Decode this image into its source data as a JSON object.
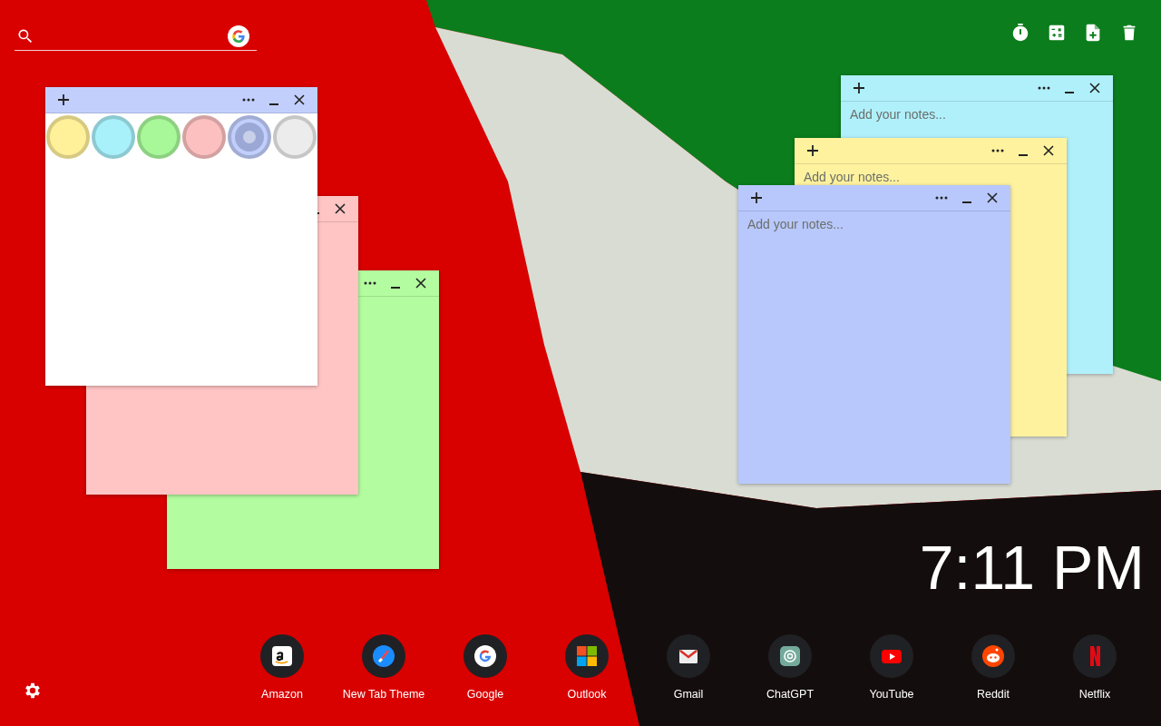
{
  "notes": [
    {
      "kind": "text",
      "color": "#b3fca0"
    },
    {
      "kind": "text",
      "color": "#ffc4c4"
    },
    {
      "kind": "palette",
      "color": "#ffffff",
      "swatches": [
        {
          "color": "#fff09a",
          "selected": false
        },
        {
          "color": "#a8f0fa",
          "selected": false
        },
        {
          "color": "#a8f89a",
          "selected": false
        },
        {
          "color": "#fcc0c0",
          "selected": false
        },
        {
          "color": "#c2cffc",
          "selected": true
        },
        {
          "color": "#ececec",
          "selected": false
        }
      ]
    },
    {
      "kind": "text",
      "color": "#b0f0fb",
      "placeholder": "Add your notes..."
    },
    {
      "kind": "text",
      "color": "#fff29e",
      "placeholder": "Add your notes..."
    },
    {
      "kind": "text",
      "color": "#b8c8fc",
      "placeholder": "Add your notes..."
    }
  ],
  "clock": {
    "time": "7:11 PM"
  },
  "shortcuts": [
    {
      "kind": "amazon",
      "label": "Amazon"
    },
    {
      "kind": "brush",
      "label": "New Tab Theme"
    },
    {
      "kind": "google",
      "label": "Google"
    },
    {
      "kind": "windows",
      "label": "Outlook"
    },
    {
      "kind": "mail",
      "label": "Gmail"
    },
    {
      "kind": "chatgpt",
      "label": "ChatGPT"
    },
    {
      "kind": "youtube",
      "label": "YouTube"
    },
    {
      "kind": "reddit",
      "label": "Reddit"
    },
    {
      "kind": "netflix",
      "label": "Netflix"
    }
  ]
}
